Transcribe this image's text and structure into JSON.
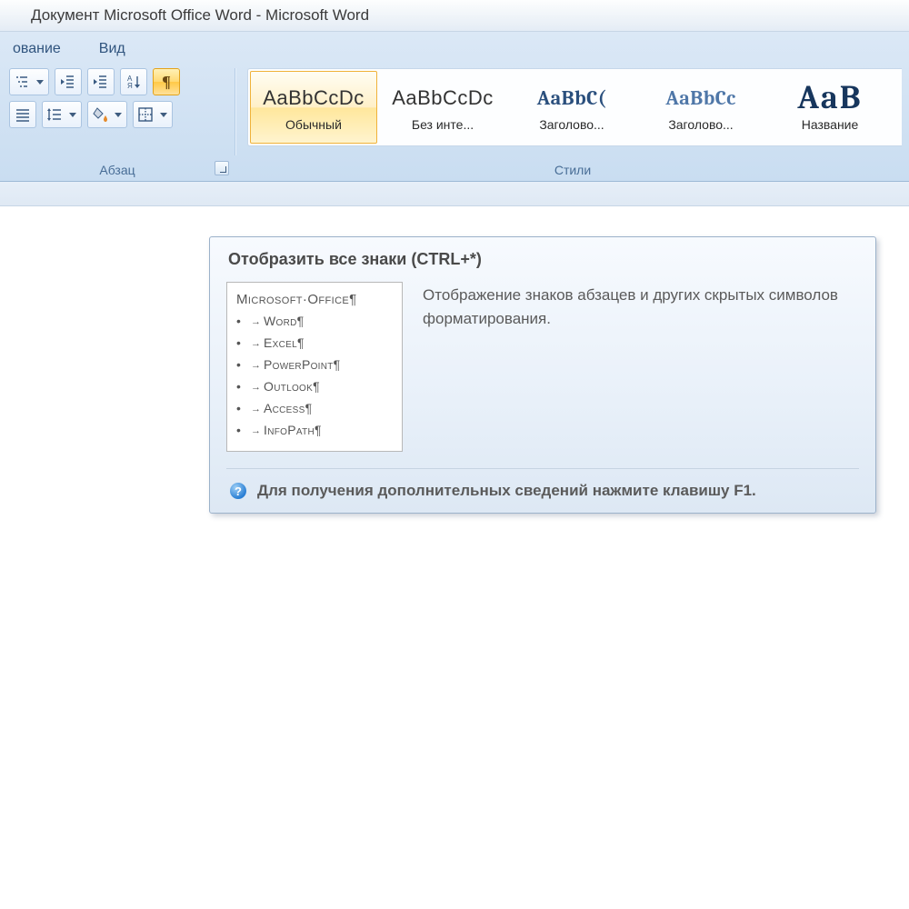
{
  "title": "Документ Microsoft Office Word - Microsoft Word",
  "tabs": {
    "t0": "ование",
    "t1": "Вид"
  },
  "paragraph_group_label": "Абзац",
  "styles_group_label": "Стили",
  "styles": [
    {
      "sample": "AaBbCcDc",
      "label": "Обычный",
      "pil": true,
      "kind": "plain",
      "selected": true
    },
    {
      "sample": "AaBbCcDc",
      "label": "Без инте...",
      "pil": true,
      "kind": "plain"
    },
    {
      "sample": "AaBbC(",
      "label": "Заголово...",
      "pil": false,
      "kind": "navy"
    },
    {
      "sample": "AaBbCc",
      "label": "Заголово...",
      "pil": false,
      "kind": "navylight"
    },
    {
      "sample": "AaB",
      "label": "Название",
      "pil": false,
      "kind": "big"
    }
  ],
  "tooltip": {
    "title": "Отобразить все знаки (CTRL+*)",
    "preview_heading": "Microsoft·Office¶",
    "preview_items": [
      "Word¶",
      "Excel¶",
      "PowerPoint¶",
      "Outlook¶",
      "Access¶",
      "InfoPath¶"
    ],
    "description": "Отображение знаков абзацев и других скрытых символов форматирования.",
    "footer": "Для получения дополнительных сведений нажмите клавишу F1."
  }
}
